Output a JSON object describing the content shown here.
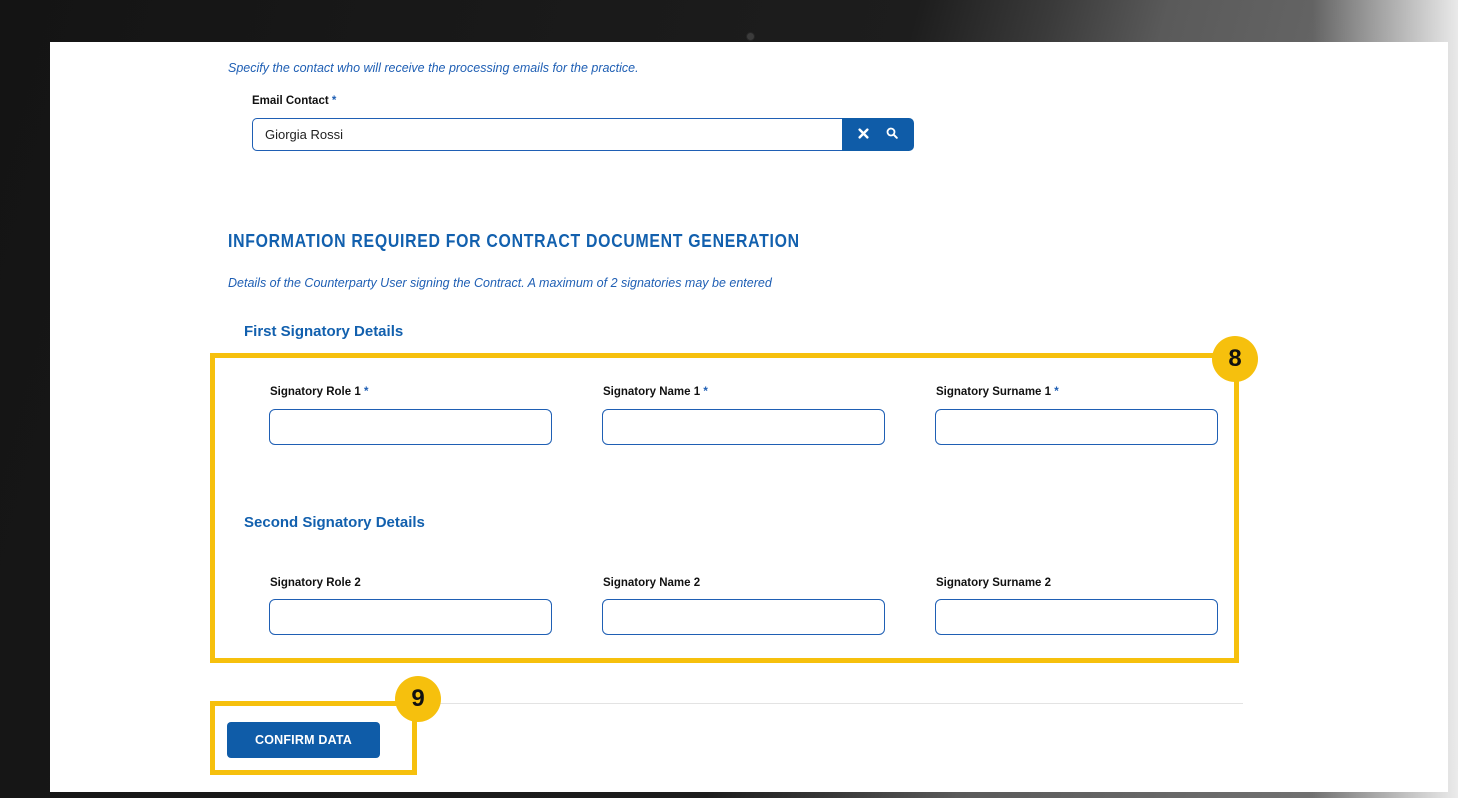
{
  "email_section": {
    "intro": "Specify the contact who will receive the processing emails for the practice.",
    "label": "Email Contact",
    "required_mark": "*",
    "value": "Giorgia Rossi",
    "clear_glyph": "✖",
    "search_glyph": "🔍"
  },
  "contract_section": {
    "title": "INFORMATION REQUIRED FOR CONTRACT DOCUMENT GENERATION",
    "note": "Details of the Counterparty User signing the Contract. A maximum of 2 signatories may be entered",
    "first": {
      "title": "First Signatory Details",
      "role_label": "Signatory Role 1",
      "name_label": "Signatory Name 1",
      "surname_label": "Signatory Surname 1",
      "required_mark": "*"
    },
    "second": {
      "title": "Second Signatory Details",
      "role_label": "Signatory Role 2",
      "name_label": "Signatory Name 2",
      "surname_label": "Signatory Surname 2"
    }
  },
  "annotations": {
    "step8": "8",
    "step9": "9",
    "highlight_color": "#f6c00d"
  },
  "actions": {
    "confirm_label": "CONFIRM DATA"
  },
  "colors": {
    "primary": "#0f5ca8",
    "accent_text": "#1f5fb4"
  }
}
